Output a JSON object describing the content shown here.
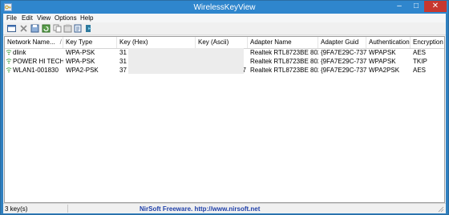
{
  "window": {
    "title": "WirelessKeyView"
  },
  "menu": [
    "File",
    "Edit",
    "View",
    "Options",
    "Help"
  ],
  "toolbar": [
    "properties-icon",
    "delete-icon",
    "save-icon",
    "refresh-icon",
    "copy-icon",
    "report-icon",
    "export-icon",
    "exit-icon"
  ],
  "columns": [
    "Network Name...",
    "Key Type",
    "Key (Hex)",
    "Key (Ascii)",
    "Adapter Name",
    "Adapter Guid",
    "Authentication",
    "Encryption"
  ],
  "sort_indicator": "/",
  "rows": [
    {
      "name": "dlink",
      "key_type": "WPA-PSK",
      "key_hex": "31",
      "key_ascii": "",
      "adapter": "Realtek RTL8723BE 802.11...",
      "guid": "{9FA7E29C-737A...",
      "auth": "WPAPSK",
      "enc": "AES"
    },
    {
      "name": "POWER HI TECH",
      "key_type": "WPA-PSK",
      "key_hex": "31",
      "key_ascii": "",
      "adapter": "Realtek RTL8723BE 802.11...",
      "guid": "{9FA7E29C-737A...",
      "auth": "WPAPSK",
      "enc": "TKIP"
    },
    {
      "name": "WLAN1-001830",
      "key_type": "WPA2-PSK",
      "key_hex": "37",
      "key_ascii": "7",
      "adapter": "Realtek RTL8723BE 802.11...",
      "guid": "{9FA7E29C-737A...",
      "auth": "WPA2PSK",
      "enc": "AES"
    }
  ],
  "status": {
    "count": "3 key(s)",
    "link": "NirSoft Freeware.  http://www.nirsoft.net"
  },
  "colors": {
    "titlebar": "#2f86cd",
    "close": "#c7372f",
    "link": "#1f3fa8"
  }
}
